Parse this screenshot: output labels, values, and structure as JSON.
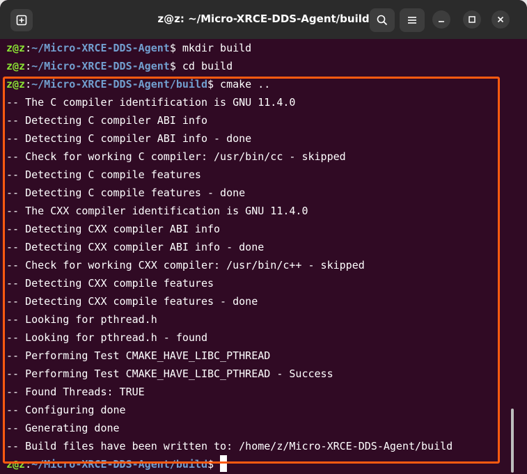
{
  "window": {
    "title": "z@z: ~/Micro-XRCE-DDS-Agent/build"
  },
  "titlebar": {
    "new_tab_icon": "new-tab-icon",
    "search_icon": "search-icon",
    "menu_icon": "hamburger-menu-icon",
    "minimize_icon": "minimize-icon",
    "maximize_icon": "maximize-icon",
    "close_icon": "close-icon"
  },
  "colors": {
    "terminal_bg": "#300a24",
    "prompt_user": "#8ae234",
    "prompt_path": "#729fcf",
    "highlight": "#ff5a10"
  },
  "terminal": {
    "prompts": [
      {
        "user": "z@z",
        "sep": ":",
        "path": "~/Micro-XRCE-DDS-Agent",
        "symbol": "$",
        "command": " mkdir build"
      },
      {
        "user": "z@z",
        "sep": ":",
        "path": "~/Micro-XRCE-DDS-Agent",
        "symbol": "$",
        "command": " cd build"
      },
      {
        "user": "z@z",
        "sep": ":",
        "path": "~/Micro-XRCE-DDS-Agent/build",
        "symbol": "$",
        "command": " cmake .."
      }
    ],
    "output": [
      "-- The C compiler identification is GNU 11.4.0",
      "-- Detecting C compiler ABI info",
      "-- Detecting C compiler ABI info - done",
      "-- Check for working C compiler: /usr/bin/cc - skipped",
      "-- Detecting C compile features",
      "-- Detecting C compile features - done",
      "-- The CXX compiler identification is GNU 11.4.0",
      "-- Detecting CXX compiler ABI info",
      "-- Detecting CXX compiler ABI info - done",
      "-- Check for working CXX compiler: /usr/bin/c++ - skipped",
      "-- Detecting CXX compile features",
      "-- Detecting CXX compile features - done",
      "-- Looking for pthread.h",
      "-- Looking for pthread.h - found",
      "-- Performing Test CMAKE_HAVE_LIBC_PTHREAD",
      "-- Performing Test CMAKE_HAVE_LIBC_PTHREAD - Success",
      "-- Found Threads: TRUE",
      "-- Configuring done",
      "-- Generating done",
      "-- Build files have been written to: /home/z/Micro-XRCE-DDS-Agent/build"
    ],
    "final_prompt": {
      "user": "z@z",
      "sep": ":",
      "path": "~/Micro-XRCE-DDS-Agent/build",
      "symbol": "$",
      "command": " "
    }
  }
}
